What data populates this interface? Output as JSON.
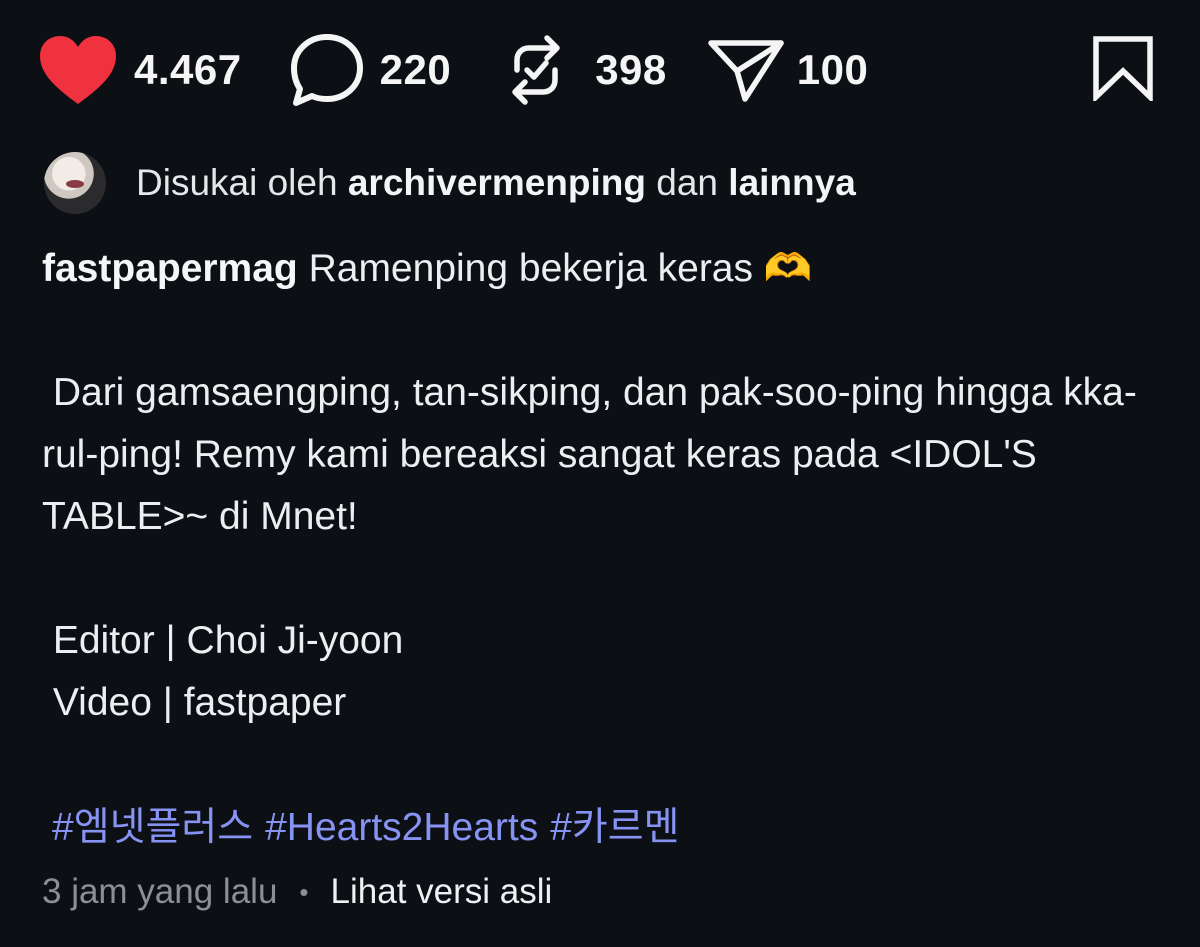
{
  "actions": {
    "likes": "4.467",
    "comments": "220",
    "reposts": "398",
    "shares": "100",
    "like_color": "#f0313e"
  },
  "liked_by": {
    "prefix": "Disukai oleh",
    "user": "archivermenping",
    "conjunction": "dan",
    "others": "lainnya"
  },
  "post": {
    "username": "fastpapermag",
    "title_line": "Ramenping bekerja keras 🫶",
    "body_line1": " Dari gamsaengping, tan-sikping, dan pak-soo-ping hingga kka-rul-ping! Remy kami bereaksi sangat keras pada <IDOL'S TABLE>~ di Mnet!",
    "editor_line": " Editor | Choi Ji-yoon",
    "video_line": " Video | fastpaper",
    "hashtags": [
      "#엠넷플러스",
      "#Hearts2Hearts",
      "#카르멘"
    ]
  },
  "footer": {
    "time": "3 jam yang lalu",
    "separator": "•",
    "see_original": "Lihat versi asli"
  }
}
